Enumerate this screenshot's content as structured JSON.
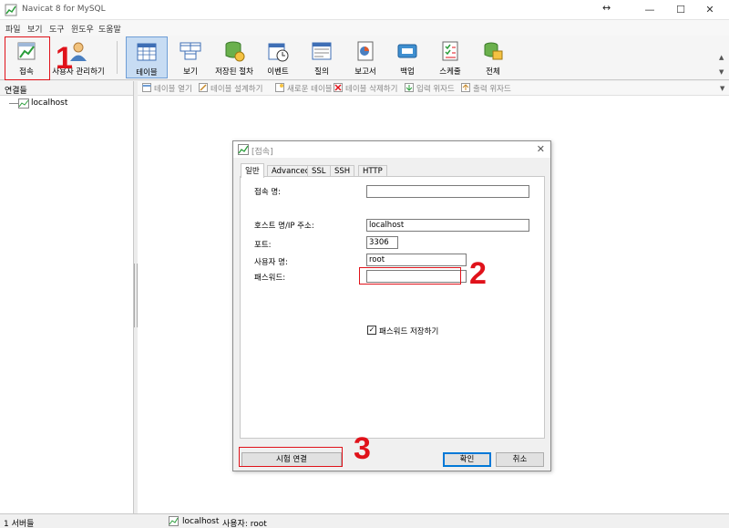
{
  "window": {
    "title": "Navicat 8 for MySQL",
    "minimize_glyph": "—",
    "maximize_glyph": "☐",
    "close_glyph": "✕",
    "resize_glyph": "↔"
  },
  "menu": [
    "파일",
    "보기",
    "도구",
    "윈도우",
    "도움말"
  ],
  "toolbar": {
    "connect": "접속",
    "user_manager": "사용자 관리하기",
    "tables": "테이블",
    "views": "보기",
    "procedures": "저장된 절차",
    "events": "이벤트",
    "queries": "질의",
    "reports": "보고서",
    "backup": "백업",
    "schedule": "스케줄",
    "all": "전체"
  },
  "left_panel": {
    "header": "연결들",
    "items": [
      "localhost"
    ]
  },
  "subtoolbar": {
    "open_table": "테이블 열기",
    "design_table": "테이블 설계하기",
    "new_table": "새로운 테이블",
    "delete_table": "테이블 삭제하기",
    "import_wizard": "입력 위자드",
    "export_wizard": "출력 위자드"
  },
  "dialog": {
    "title": "[접속]",
    "close_glyph": "✕",
    "tabs": [
      "일반",
      "Advanced",
      "SSL",
      "SSH",
      "HTTP"
    ],
    "fields": {
      "connection_name_label": "접속 명:",
      "connection_name_value": "",
      "host_label": "호스트 명/IP 주소:",
      "host_value": "localhost",
      "port_label": "포트:",
      "port_value": "3306",
      "username_label": "사용자 명:",
      "username_value": "root",
      "password_label": "패스워드:",
      "password_value": ""
    },
    "save_password": {
      "label": "패스워드 저장하기",
      "checked": true,
      "glyph": "✓"
    },
    "test_button": "시험 연결",
    "ok_button": "확인",
    "cancel_button": "취소"
  },
  "annotations": {
    "step1": "1",
    "step2": "2",
    "step3": "3",
    "color": "#e0121a"
  },
  "statusbar": {
    "server_count": "1 서버들",
    "connection": "localhost",
    "user": "사용자: root"
  },
  "colors": {
    "active_tool_bg": "#c7dcf3",
    "active_tool_border": "#6f9ed6",
    "default_button_border": "#0078d7"
  }
}
